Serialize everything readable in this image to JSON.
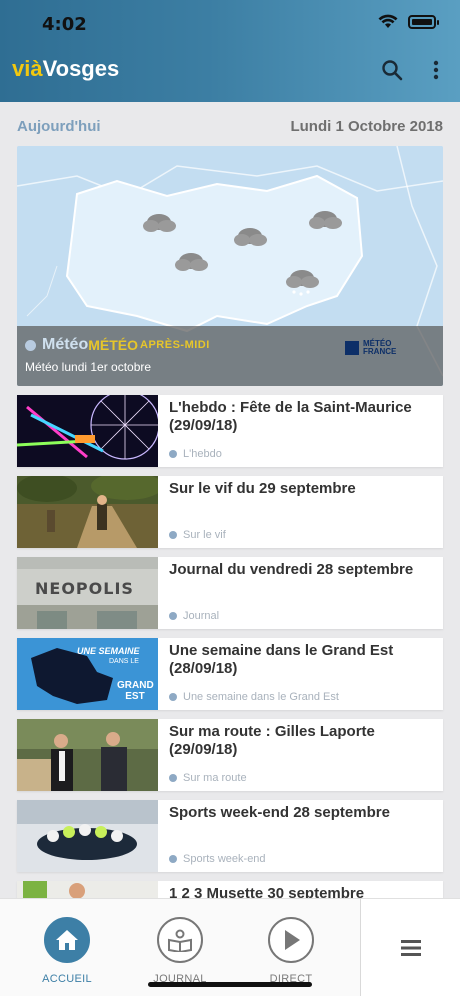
{
  "status_bar": {
    "time": "4:02"
  },
  "app": {
    "logo_via": "vià",
    "logo_name": "Vosges"
  },
  "header_icons": [
    "search-icon",
    "more-vertical-icon"
  ],
  "date_row": {
    "today": "Aujourd'hui",
    "date": "Lundi 1 Octobre 2018"
  },
  "hero": {
    "category": "Météo",
    "overlay_text": "MÉTÉO",
    "overlay_sub": "APRÈS-MIDI",
    "subtitle": "Météo lundi 1er octobre",
    "partner_logo": "MÉTÉO FRANCE"
  },
  "items": [
    {
      "title": "L'hebdo : Fête de la Saint-Maurice (29/09/18)",
      "category": "L'hebdo"
    },
    {
      "title": "Sur le vif du 29 septembre",
      "category": "Sur le vif"
    },
    {
      "title": "Journal du vendredi 28 septembre",
      "category": "Journal",
      "thumb_text": "NEOPOLIS"
    },
    {
      "title": "Une semaine dans le Grand Est (28/09/18)",
      "category": "Une semaine dans le Grand Est",
      "thumb_text_1": "UNE SEMAINE",
      "thumb_text_2": "DANS LE",
      "thumb_text_3": "GRAND EST"
    },
    {
      "title": "Sur ma route : Gilles Laporte (29/09/18)",
      "category": "Sur ma route"
    },
    {
      "title": "Sports week-end 28 septembre",
      "category": "Sports week-end"
    },
    {
      "title": "1 2 3 Musette 30 septembre",
      "category": ""
    }
  ],
  "tabs": [
    {
      "label": "ACCUEIL",
      "icon": "home-icon",
      "active": true
    },
    {
      "label": "JOURNAL",
      "icon": "journal-icon",
      "active": false
    },
    {
      "label": "DIRECT",
      "icon": "play-icon",
      "active": false
    }
  ],
  "menu_icon": "hamburger-icon",
  "colors": {
    "accent": "#3d7fa6",
    "logo_yellow": "#f2c80f",
    "header_start": "#2f6e93"
  }
}
